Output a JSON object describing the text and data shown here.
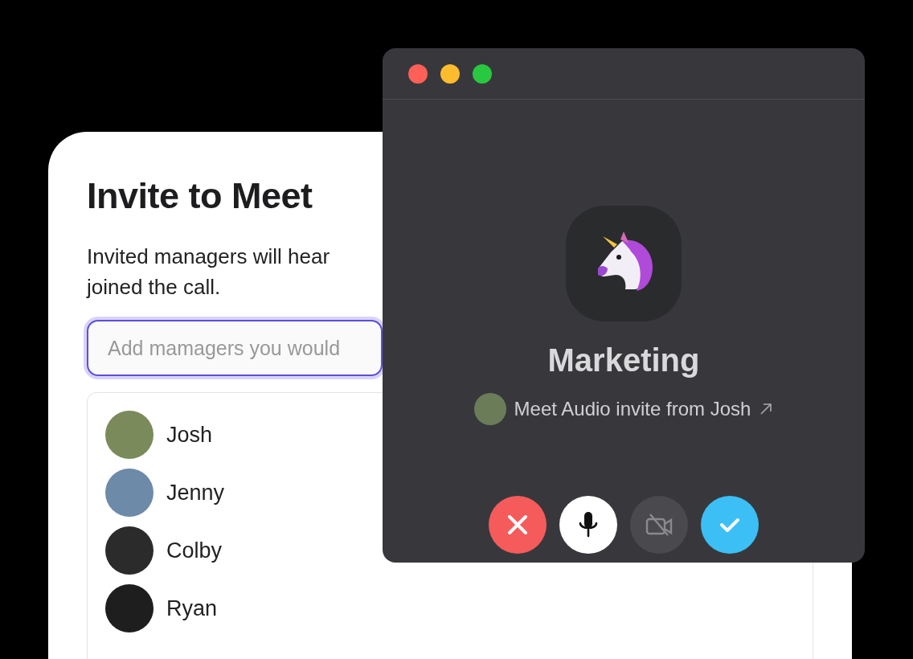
{
  "invite_card": {
    "title": "Invite to Meet",
    "description": "Invited managers will hear joined the call.",
    "search": {
      "placeholder": "Add mamagers you would"
    },
    "managers": [
      {
        "name": "Josh"
      },
      {
        "name": "Jenny"
      },
      {
        "name": "Colby"
      },
      {
        "name": "Ryan"
      }
    ]
  },
  "call_window": {
    "group_name": "Marketing",
    "invite_text": "Meet Audio invite from Josh",
    "controls": [
      {
        "kind": "decline"
      },
      {
        "kind": "microphone"
      },
      {
        "kind": "camera_off"
      },
      {
        "kind": "accept"
      }
    ]
  }
}
